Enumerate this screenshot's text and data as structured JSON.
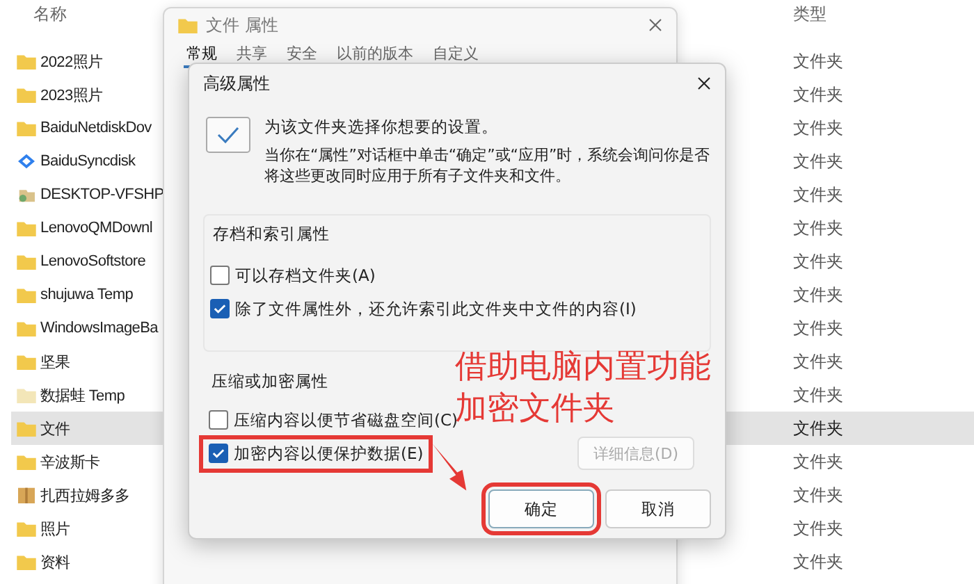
{
  "explorer": {
    "columns": [
      "名称",
      "类型"
    ],
    "rows": [
      {
        "name": "2022照片",
        "type": "文件夹",
        "kind": "folder",
        "selected": false
      },
      {
        "name": "2023照片",
        "type": "文件夹",
        "kind": "folder",
        "selected": false
      },
      {
        "name": "BaiduNetdiskDov",
        "type": "文件夹",
        "kind": "folder",
        "selected": false
      },
      {
        "name": "BaiduSyncdisk",
        "type": "文件夹",
        "kind": "sync",
        "selected": false
      },
      {
        "name": "DESKTOP-VFSHP",
        "type": "文件夹",
        "kind": "computer",
        "selected": false
      },
      {
        "name": "LenovoQMDownl",
        "type": "文件夹",
        "kind": "folder",
        "selected": false
      },
      {
        "name": "LenovoSoftstore",
        "type": "文件夹",
        "kind": "folder",
        "selected": false
      },
      {
        "name": "shujuwa Temp",
        "type": "文件夹",
        "kind": "folder",
        "selected": false
      },
      {
        "name": "WindowsImageBa",
        "type": "文件夹",
        "kind": "folder",
        "selected": false
      },
      {
        "name": "坚果",
        "type": "文件夹",
        "kind": "folder",
        "selected": false
      },
      {
        "name": "数据蛙 Temp",
        "type": "文件夹",
        "kind": "pale",
        "selected": false
      },
      {
        "name": "文件",
        "type": "文件夹",
        "kind": "folder",
        "selected": true
      },
      {
        "name": "辛波斯卡",
        "type": "文件夹",
        "kind": "folder",
        "selected": false
      },
      {
        "name": "扎西拉姆多多",
        "type": "文件夹",
        "kind": "archive",
        "selected": false
      },
      {
        "name": "照片",
        "type": "文件夹",
        "kind": "folder",
        "selected": false
      },
      {
        "name": "资料",
        "type": "文件夹",
        "kind": "folder",
        "selected": false
      }
    ]
  },
  "properties_window": {
    "title": "文件 属性",
    "tabs": [
      {
        "label": "常规",
        "selected": true
      },
      {
        "label": "共享",
        "selected": false
      },
      {
        "label": "安全",
        "selected": false
      },
      {
        "label": "以前的版本",
        "selected": false
      },
      {
        "label": "自定义",
        "selected": false
      }
    ]
  },
  "advanced_dialog": {
    "title": "高级属性",
    "intro": "为该文件夹选择你想要的设置。",
    "description": "当你在“属性”对话框中单击“确定”或“应用”时，系统会询问你是否将这些更改同时应用于所有子文件夹和文件。",
    "groups": [
      {
        "title": "存档和索引属性",
        "options": [
          {
            "label": "可以存档文件夹(A)",
            "checked": false,
            "highlighted": false
          },
          {
            "label": "除了文件属性外，还允许索引此文件夹中文件的内容(I)",
            "checked": true,
            "highlighted": false
          }
        ]
      },
      {
        "title": "压缩或加密属性",
        "options": [
          {
            "label": "压缩内容以便节省磁盘空间(C)",
            "checked": false,
            "highlighted": false
          },
          {
            "label": "加密内容以便保护数据(E)",
            "checked": true,
            "highlighted": true
          }
        ]
      }
    ],
    "details_button": {
      "label": "详细信息(D)",
      "disabled": true
    },
    "buttons": [
      {
        "label": "确定",
        "highlighted": true
      },
      {
        "label": "取消",
        "highlighted": false
      }
    ]
  },
  "annotation": {
    "lines": [
      "借助电脑内置功能",
      "加密文件夹"
    ]
  }
}
